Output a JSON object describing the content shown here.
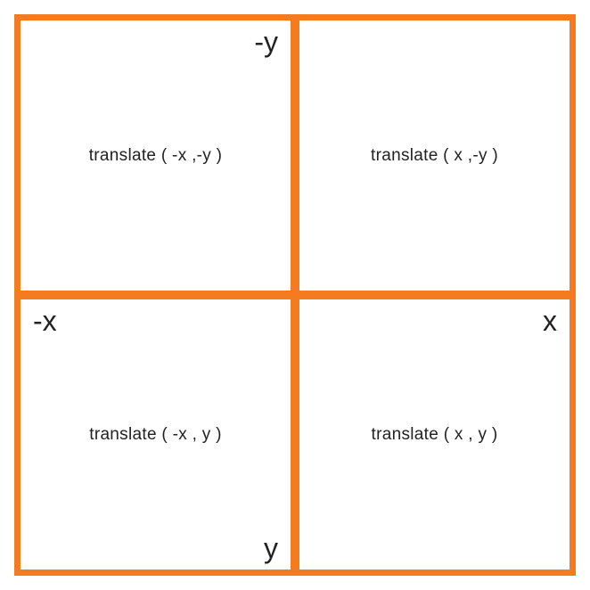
{
  "axes": {
    "y_neg": "-y",
    "x_neg": "-x",
    "x_pos": "x",
    "y_pos": "y"
  },
  "quadrants": {
    "top_left": "translate ( -x ,-y )",
    "top_right": "translate ( x ,-y )",
    "bot_left": "translate ( -x , y )",
    "bot_right": "translate ( x , y )"
  },
  "colors": {
    "border": "#f47b20",
    "text": "#222222"
  }
}
